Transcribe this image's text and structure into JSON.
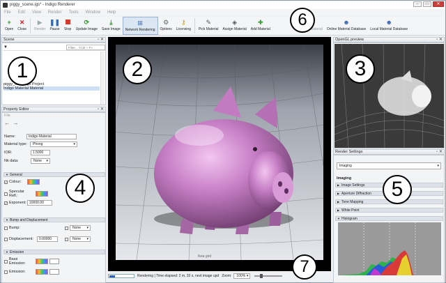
{
  "window": {
    "title": "piggy_scene.igs* - Indigo Renderer"
  },
  "menu": [
    "File",
    "Edit",
    "View",
    "Render",
    "Tools",
    "Window",
    "Help"
  ],
  "toolbar": [
    {
      "label": "Open",
      "icon": "plus-icon",
      "disabled": false
    },
    {
      "label": "Close",
      "icon": "close-x-icon",
      "disabled": false
    },
    {
      "label": "Render",
      "icon": "play-icon",
      "disabled": true
    },
    {
      "label": "Pause",
      "icon": "pause-icon",
      "disabled": false
    },
    {
      "label": "Stop",
      "icon": "stop-icon",
      "disabled": false
    },
    {
      "label": "Update Image",
      "icon": "refresh-icon",
      "disabled": false
    },
    {
      "label": "Save Image",
      "icon": "save-down-icon",
      "disabled": false
    },
    {
      "label": "Network Rendering",
      "icon": "network-icon",
      "disabled": false,
      "active": true
    },
    {
      "label": "Options",
      "icon": "gear-icon",
      "disabled": false
    },
    {
      "label": "Licensing",
      "icon": "key-icon",
      "disabled": false
    },
    {
      "label": "Pick Material",
      "icon": "eyedropper-icon",
      "disabled": false
    },
    {
      "label": "Assign Material",
      "icon": "paint-bucket-icon",
      "disabled": false
    },
    {
      "label": "Add Material",
      "icon": "add-material-icon",
      "disabled": false
    },
    {
      "label": "Upload Material",
      "icon": "upload-icon",
      "disabled": true
    },
    {
      "label": "Online Material Database",
      "icon": "globe-person-icon",
      "disabled": false
    },
    {
      "label": "Local Material Database",
      "icon": "person-db-icon",
      "disabled": false
    }
  ],
  "scene": {
    "title": "Scene",
    "filter_placeholder": "Filter... <Ctrl + F>",
    "tree": [
      "piggy_scene.igs Project",
      "Indigo Material  Material"
    ]
  },
  "property_editor": {
    "title": "Property Editor",
    "path": "File",
    "name_label": "Name:",
    "name_value": "Indigo Material",
    "type_label": "Material type:",
    "type_value": "Phong",
    "ior_label": "IOR:",
    "ior_value": "1.5000",
    "nk_label": "Nk data:",
    "nk_value": "None",
    "sections": {
      "general": "General",
      "bump": "Bump and Displacement",
      "emission": "Emission"
    },
    "general_rows": [
      "Colour:",
      "Specular Refl.:",
      "Exponent:"
    ],
    "exponent_value": "10000.00",
    "bump_rows": [
      "Bump:",
      "Displacement:"
    ],
    "displacement_value": "0.00000",
    "none_label": "None",
    "emission_rows": [
      "Base Emission:",
      "Emission:"
    ]
  },
  "render_view": {
    "status": "Rendering | Time elapsed: 2 m, 33 s, next image upd",
    "zoom_label": "Zoom:",
    "zoom_value": "100%",
    "progress": 0.22,
    "floor_label": "Ikea grid"
  },
  "opengl": {
    "title": "OpenGL preview"
  },
  "render_settings": {
    "title": "Render Settings",
    "mode": "Imaging",
    "heading": "Imaging",
    "sections": [
      "Image Settings",
      "Aperture Diffraction",
      "Tone Mapping",
      "White Point",
      "Histogram"
    ]
  },
  "callouts": [
    "1",
    "2",
    "3",
    "4",
    "5",
    "6",
    "7"
  ]
}
